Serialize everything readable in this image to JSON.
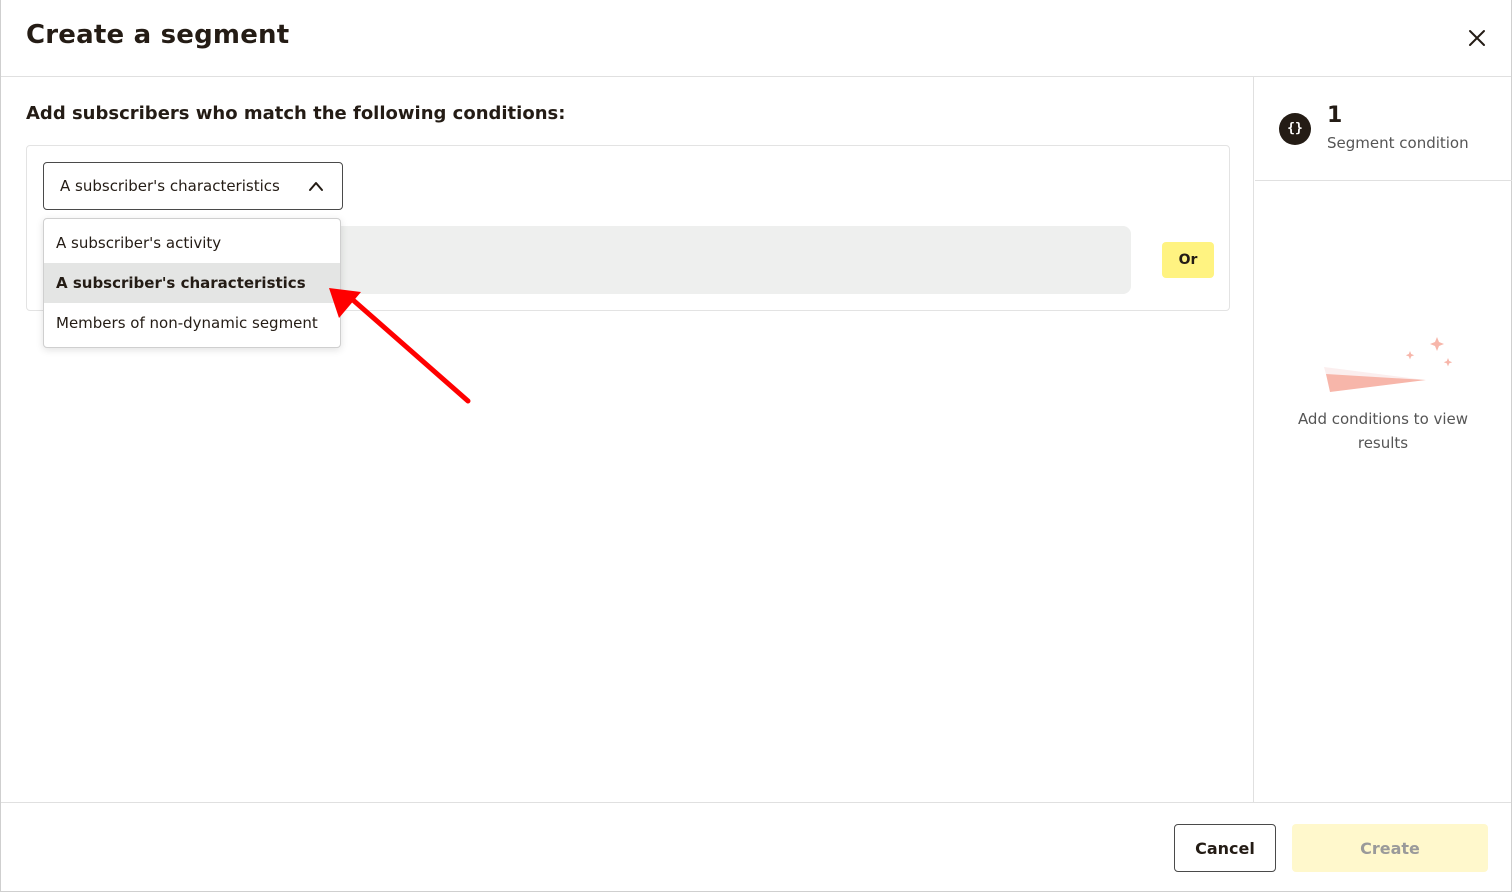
{
  "header": {
    "title": "Create a segment",
    "close_icon": "close-icon"
  },
  "main": {
    "instructions": "Add subscribers who match the following conditions:",
    "condition": {
      "select_value": "A subscriber's characteristics",
      "select_icon": "chevron-up-icon",
      "dropdown_open": true,
      "options": [
        {
          "label": "A subscriber's activity",
          "selected": false
        },
        {
          "label": "A subscriber's characteristics",
          "selected": true
        },
        {
          "label": "Members of non-dynamic segment",
          "selected": false
        }
      ],
      "or_label": "Or"
    }
  },
  "sidebar": {
    "icon": "curly-braces-icon",
    "icon_glyph": "{}",
    "count": "1",
    "count_label": "Segment condition",
    "empty_icon": "paper-plane-sparkles-illustration",
    "empty_text": "Add conditions to view results"
  },
  "footer": {
    "cancel_label": "Cancel",
    "create_label": "Create",
    "create_disabled": true
  },
  "annotation": {
    "type": "red-arrow",
    "color": "#ff0000",
    "points_to": "A subscriber's characteristics"
  },
  "colors": {
    "accent_yellow": "#fff381",
    "disabled_yellow": "#fff8cc",
    "text_dark": "#241c15",
    "placeholder_gray": "#eeefee",
    "selected_option_bg": "#e4e5e4"
  }
}
